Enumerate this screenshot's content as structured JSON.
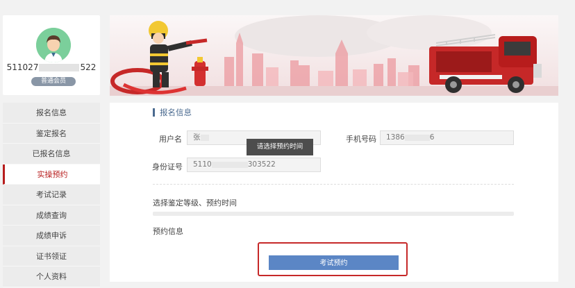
{
  "profile": {
    "id_prefix": "511027",
    "id_suffix": "522",
    "badge": "普通会员"
  },
  "sidebar": {
    "items": [
      {
        "label": "报名信息",
        "active": false
      },
      {
        "label": "鉴定报名",
        "active": false
      },
      {
        "label": "已报名信息",
        "active": false
      },
      {
        "label": "实操预约",
        "active": true
      },
      {
        "label": "考试记录",
        "active": false
      },
      {
        "label": "成绩查询",
        "active": false
      },
      {
        "label": "成绩申诉",
        "active": false
      },
      {
        "label": "证书领证",
        "active": false
      },
      {
        "label": "个人资料",
        "active": false
      }
    ]
  },
  "form": {
    "section_title": "报名信息",
    "username_label": "用户名",
    "username_value": "张",
    "phone_label": "手机号码",
    "phone_prefix": "1386",
    "phone_suffix": "6",
    "idcard_label": "身份证号",
    "idcard_prefix": "5110",
    "idcard_suffix": "303522",
    "tooltip": "请选择预约时间",
    "select_prompt": "选择鉴定等级、预约时间",
    "booking_info_label": "预约信息",
    "submit_label": "考试预约"
  },
  "colors": {
    "accent_red": "#c62828",
    "button_blue": "#5b86c5",
    "title_blue": "#4a6a8f"
  }
}
